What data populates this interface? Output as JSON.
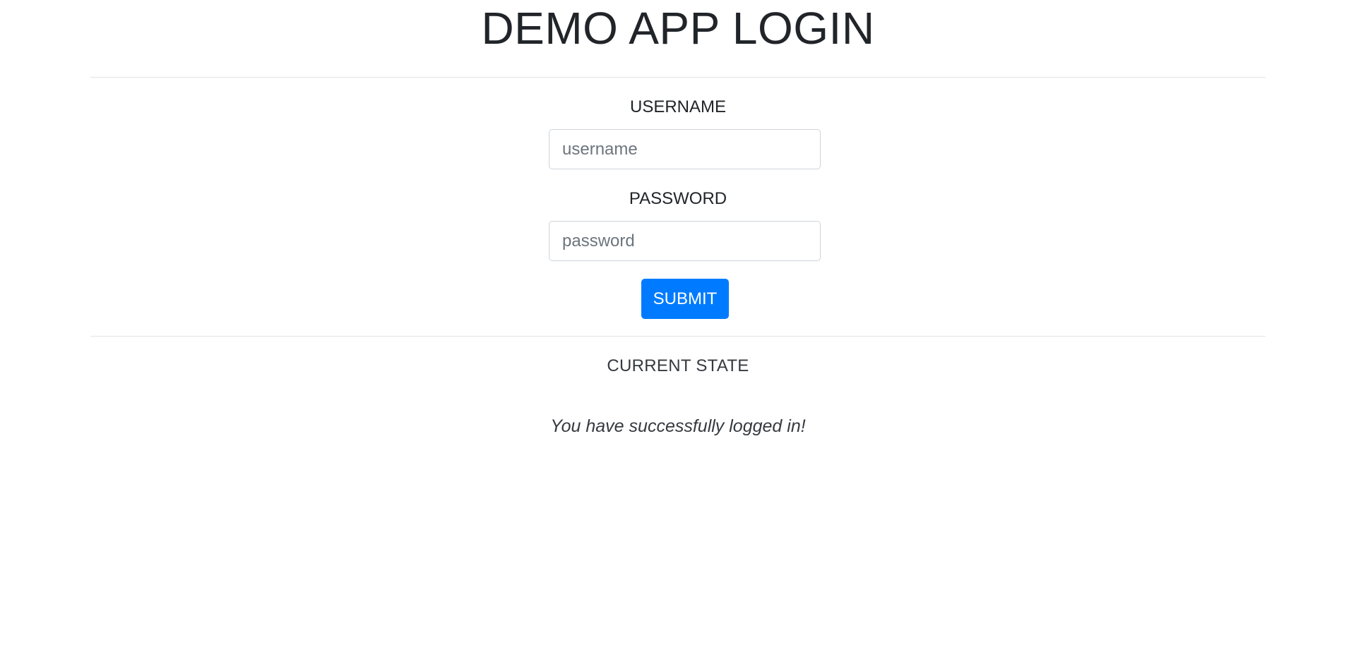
{
  "header": {
    "title": "DEMO APP LOGIN"
  },
  "form": {
    "username_label": "USERNAME",
    "username_placeholder": "username",
    "username_value": "",
    "password_label": "PASSWORD",
    "password_placeholder": "password",
    "password_value": "",
    "submit_label": "SUBMIT"
  },
  "state": {
    "heading": "CURRENT STATE",
    "message": "You have successfully logged in!"
  },
  "colors": {
    "accent": "#007bff",
    "text": "#212529",
    "divider": "#e2e4e6",
    "input_border": "#ced4da"
  }
}
